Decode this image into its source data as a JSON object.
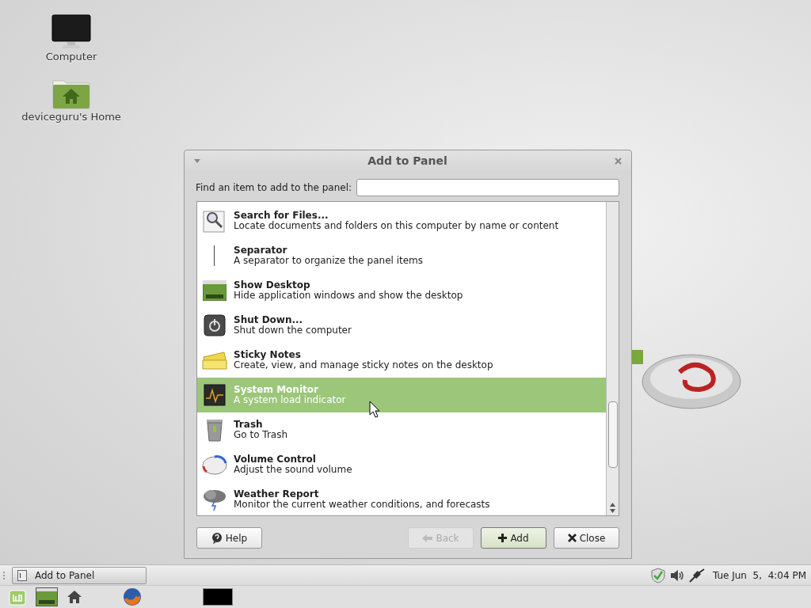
{
  "desktop_icons": [
    {
      "kind": "computer",
      "label": "Computer"
    },
    {
      "kind": "home",
      "label": "deviceguru's Home"
    }
  ],
  "dialog": {
    "title": "Add to Panel",
    "search": {
      "label": "Find an item to add to the panel:"
    },
    "items": [
      {
        "kind": "search",
        "name": "Search for Files...",
        "description": "Locate documents and folders on this computer by name or content",
        "selected": false
      },
      {
        "kind": "separator",
        "name": "Separator",
        "description": "A separator to organize the panel items",
        "selected": false
      },
      {
        "kind": "desktop",
        "name": "Show Desktop",
        "description": "Hide application windows and show the desktop",
        "selected": false
      },
      {
        "kind": "shutdown",
        "name": "Shut Down...",
        "description": "Shut down the computer",
        "selected": false
      },
      {
        "kind": "notes",
        "name": "Sticky Notes",
        "description": "Create, view, and manage sticky notes on the desktop",
        "selected": false
      },
      {
        "kind": "monitor",
        "name": "System Monitor",
        "description": "A system load indicator",
        "selected": true
      },
      {
        "kind": "trash",
        "name": "Trash",
        "description": "Go to Trash",
        "selected": false
      },
      {
        "kind": "volume",
        "name": "Volume Control",
        "description": "Adjust the sound volume",
        "selected": false
      },
      {
        "kind": "weather",
        "name": "Weather Report",
        "description": "Monitor the current weather conditions, and forecasts",
        "selected": false
      }
    ],
    "buttons": [
      {
        "kind": "help",
        "label": "Help",
        "disabled": false,
        "default": false
      },
      {
        "kind": "back",
        "label": "Back",
        "disabled": true,
        "default": false
      },
      {
        "kind": "add",
        "label": "Add",
        "disabled": false,
        "default": true
      },
      {
        "kind": "close",
        "label": "Close",
        "disabled": false,
        "default": false
      }
    ]
  },
  "panel": {
    "windows": [
      {
        "title": "Add to Panel",
        "selected": false
      }
    ],
    "clock": "Tue Jun  5,  4:04 PM",
    "launchers": [
      {
        "kind": "menu"
      },
      {
        "kind": "desktop"
      },
      {
        "kind": "home"
      },
      {
        "kind": "firefox"
      },
      {
        "kind": "terminal"
      }
    ]
  }
}
